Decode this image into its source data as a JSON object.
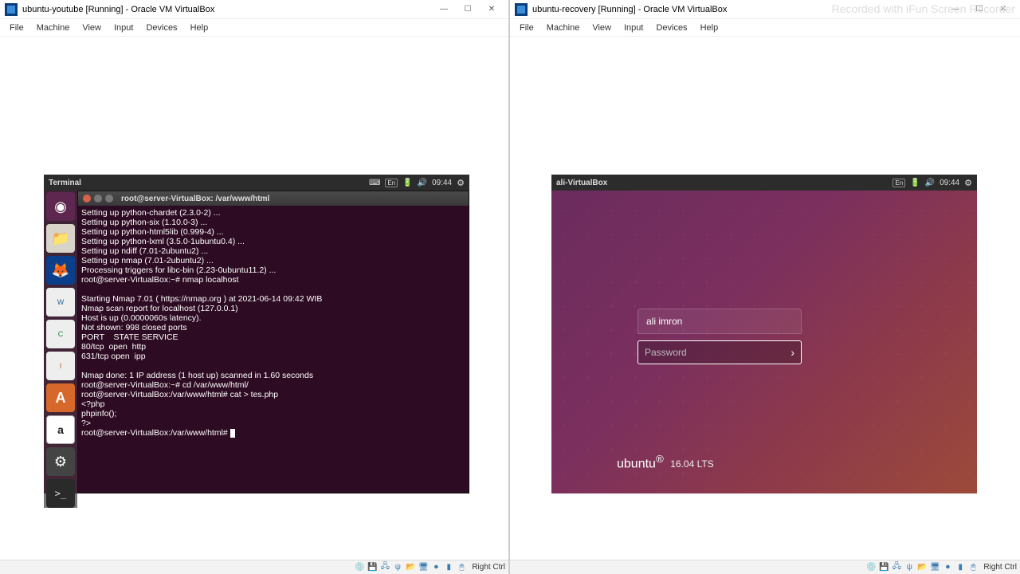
{
  "left": {
    "title": "ubuntu-youtube [Running] - Oracle VM VirtualBox",
    "menus": [
      "File",
      "Machine",
      "View",
      "Input",
      "Devices",
      "Help"
    ],
    "host_key": "Right Ctrl",
    "panel": {
      "title": "Terminal",
      "lang": "En",
      "time": "09:44"
    },
    "term_title": "root@server-VirtualBox: /var/www/html",
    "term_lines": "Setting up python-chardet (2.3.0-2) ...\nSetting up python-six (1.10.0-3) ...\nSetting up python-html5lib (0.999-4) ...\nSetting up python-lxml (3.5.0-1ubuntu0.4) ...\nSetting up ndiff (7.01-2ubuntu2) ...\nSetting up nmap (7.01-2ubuntu2) ...\nProcessing triggers for libc-bin (2.23-0ubuntu11.2) ...\nroot@server-VirtualBox:~# nmap localhost\n\nStarting Nmap 7.01 ( https://nmap.org ) at 2021-06-14 09:42 WIB\nNmap scan report for localhost (127.0.0.1)\nHost is up (0.0000060s latency).\nNot shown: 998 closed ports\nPORT    STATE SERVICE\n80/tcp  open  http\n631/tcp open  ipp\n\nNmap done: 1 IP address (1 host up) scanned in 1.60 seconds\nroot@server-VirtualBox:~# cd /var/www/html/\nroot@server-VirtualBox:/var/www/html# cat > tes.php\n<?php\nphpinfo();\n?>\nroot@server-VirtualBox:/var/www/html# "
  },
  "right": {
    "title": "ubuntu-recovery [Running] - Oracle VM VirtualBox",
    "menus": [
      "File",
      "Machine",
      "View",
      "Input",
      "Devices",
      "Help"
    ],
    "host_key": "Right Ctrl",
    "watermark": "Recorded with iFun Screen Recorder",
    "panel": {
      "host": "ali-VirtualBox",
      "lang": "En",
      "time": "09:44"
    },
    "login": {
      "user": "ali imron",
      "placeholder": "Password"
    },
    "brand": {
      "name": "ubuntu",
      "ver": "16.04 LTS"
    }
  }
}
